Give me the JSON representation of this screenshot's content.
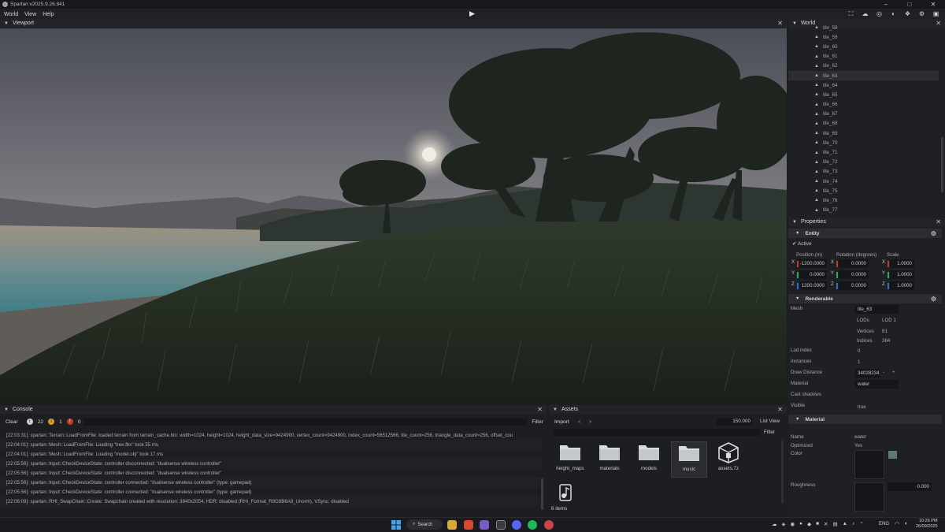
{
  "window": {
    "title": "Spartan v2025.9.26.841"
  },
  "menu": {
    "items": [
      "World",
      "View",
      "Help"
    ]
  },
  "viewport": {
    "title": "Viewport"
  },
  "world": {
    "title": "World",
    "tiles": [
      "tile_58",
      "tile_59",
      "tile_60",
      "tile_61",
      "tile_62",
      "tile_63",
      "tile_64",
      "tile_65",
      "tile_66",
      "tile_67",
      "tile_68",
      "tile_69",
      "tile_70",
      "tile_71",
      "tile_72",
      "tile_73",
      "tile_74",
      "tile_75",
      "tile_76",
      "tile_77"
    ],
    "selected": "tile_63"
  },
  "properties": {
    "title": "Properties",
    "entity": {
      "section": "Entity",
      "active_label": "Active",
      "position_label": "Position (m)",
      "rotation_label": "Rotation (degrees)",
      "scale_label": "Scale",
      "axes": [
        "X",
        "Y",
        "Z"
      ],
      "position": [
        "-1200.0000",
        "0.0000",
        "1200.0000"
      ],
      "rotation": [
        "0.0000",
        "0.0000",
        "0.0000"
      ],
      "scale": [
        "1.0000",
        "1.0000",
        "1.0000"
      ]
    },
    "renderable": {
      "section": "Renderable",
      "mesh_label": "Mesh",
      "mesh_value": "tile_63",
      "lods_label": "LODs",
      "lods_value": "LOD 1",
      "vertices_label": "Vertices",
      "vertices_value": "81",
      "indices_label": "Indices",
      "indices_value": "384",
      "lod_index_label": "Lod index",
      "lod_index_value": "0",
      "instances_label": "Instances",
      "instances_value": "1",
      "draw_distance_label": "Draw Distance",
      "draw_distance_value": "34028234",
      "draw_minus": "-",
      "draw_plus": "+",
      "material_label": "Material",
      "material_value": "water",
      "cast_shadows_label": "Cast shadows",
      "visible_label": "Visible",
      "visible_value": "true"
    },
    "material": {
      "section": "Material",
      "name_label": "Name",
      "name_value": "water",
      "optimized_label": "Optimized",
      "optimized_value": "Yes",
      "color_label": "Color",
      "roughness_label": "Roughness",
      "roughness_value": "0.000"
    }
  },
  "console": {
    "title": "Console",
    "clear_label": "Clear",
    "info_count": "22",
    "warning_count": "1",
    "error_count": "0",
    "filter_label": "Filter",
    "lines": [
      "[22:03:31]: spartan::Terrain::LoadFromFile: loaded terrain from terrain_cache.bin: width=1024, height=1024, height_data_size=9424900, vertex_count=9424900, index_count=56512566, tile_count=256, triangle_data_count=256, offset_cou",
      "[22:04:01]: spartan::Mesh::LoadFromFile: Loading \"tree.fbx\" took 55 ms",
      "[22:04:01]: spartan::Mesh::LoadFromFile: Loading \"model.obj\" took 17 ms",
      "[22:05:56]: spartan::Input::CheckDeviceState: controller disconnected: \"dualsense wireless controller\"",
      "[22:05:56]: spartan::Input::CheckDeviceState: controller disconnected: \"dualsense wireless controller\"",
      "[22:05:56]: spartan::Input::CheckDeviceState: controller connected: \"dualsense wireless controller\" (type: gamepad)",
      "[22:05:56]: spartan::Input::CheckDeviceState: controller connected: \"dualsense wireless controller\" (type: gamepad)",
      "[22:06:09]: spartan::RHI_SwapChain::Create: Swapchain created with resolution: 3840x2054, HDR: disabled (RHI_Format_R8G8B8A8_Unorm), VSync: disabled"
    ]
  },
  "assets": {
    "title": "Assets",
    "import_label": "Import",
    "back": "<",
    "forward": ">",
    "zoom_value": "150.000",
    "list_view_label": "List View",
    "filter_label": "Filter",
    "items": [
      "height_maps",
      "materials",
      "models",
      "music",
      "assets.7z"
    ],
    "selected": "music",
    "count": "6 items"
  },
  "taskbar": {
    "search_label": "Search",
    "language": "ENG",
    "time": "10:26 PM",
    "date": "26/09/2025"
  },
  "colors": {
    "accent_x": "#c0392b",
    "accent_y": "#27ae60",
    "accent_z": "#2e6fd6",
    "material_color": "#5d7a7a"
  }
}
